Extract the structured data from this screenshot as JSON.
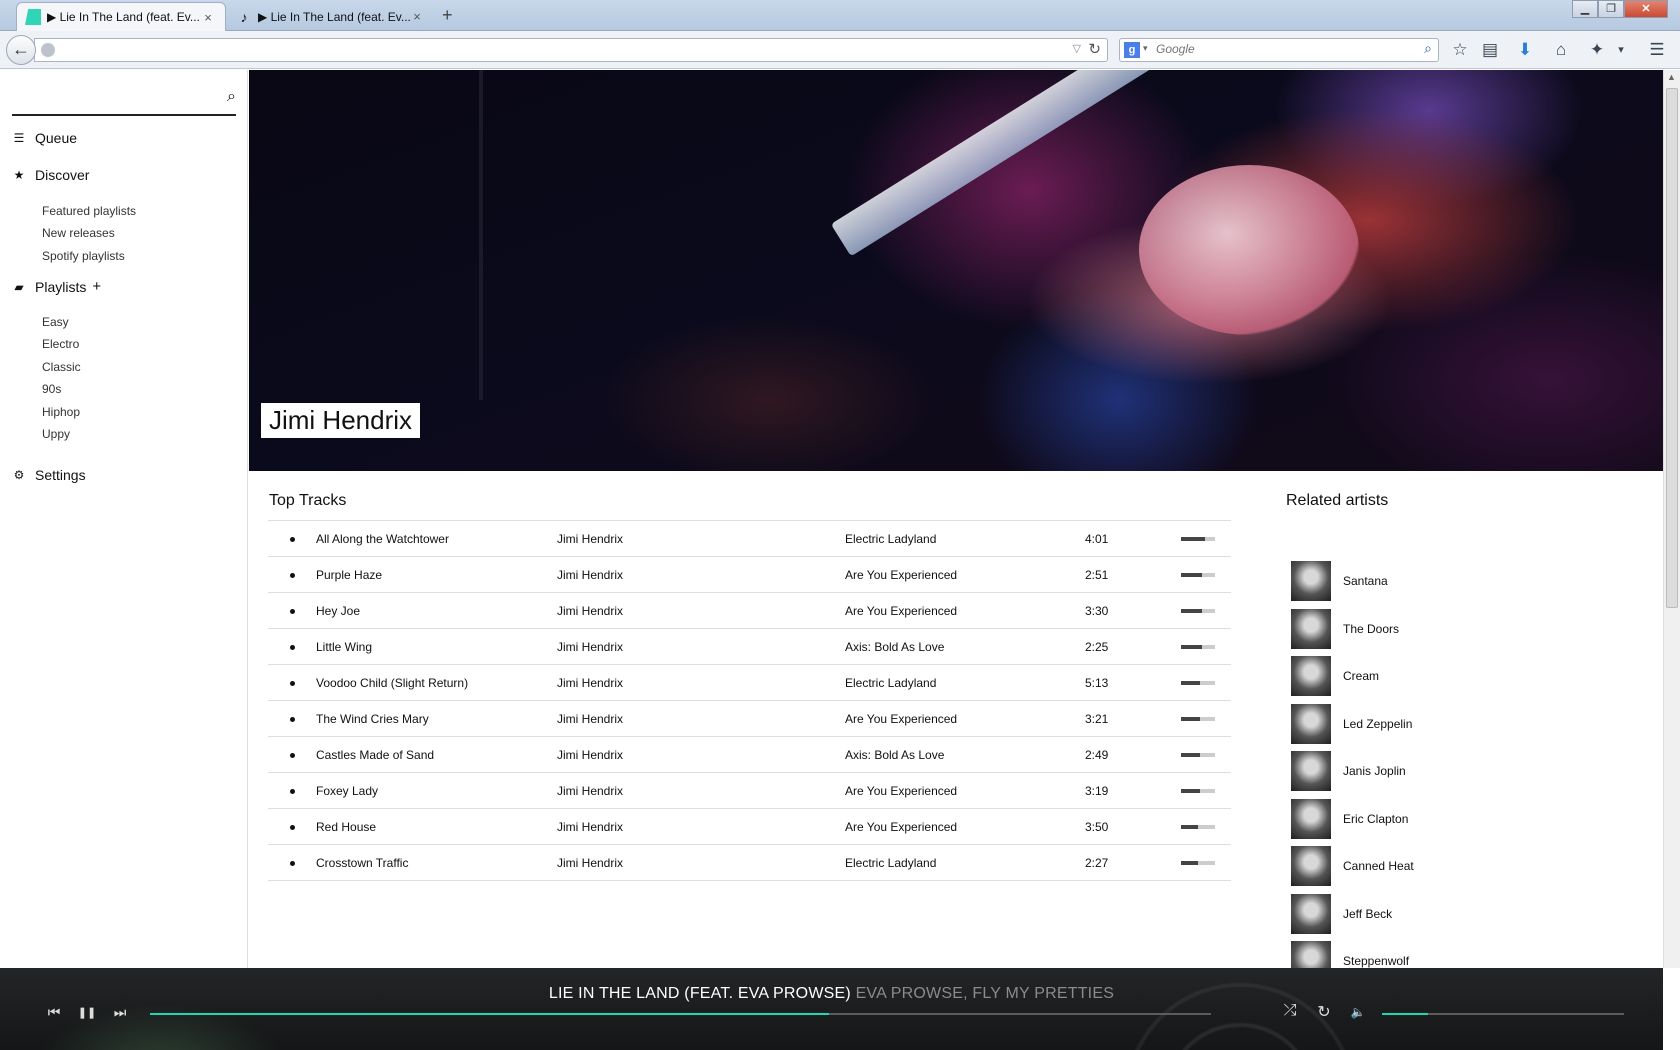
{
  "browser": {
    "tabs": [
      {
        "title": "▶ Lie In The Land (feat. Ev...",
        "close": "×"
      },
      {
        "title": "▶ Lie In The Land (feat. Ev...",
        "close": "×"
      }
    ],
    "new_tab": "+",
    "search_engine": "Google",
    "search_placeholder": "Google"
  },
  "sidebar": {
    "search_placeholder": "",
    "queue": "Queue",
    "discover": "Discover",
    "discover_items": [
      "Featured playlists",
      "New releases",
      "Spotify playlists"
    ],
    "playlists": "Playlists",
    "playlists_add": "+",
    "playlist_items": [
      "Easy",
      "Electro",
      "Classic",
      "90s",
      "Hiphop",
      "Uppy"
    ],
    "settings": "Settings"
  },
  "artist": {
    "name": "Jimi Hendrix"
  },
  "top_tracks": {
    "title": "Top Tracks",
    "rows": [
      {
        "name": "All Along the Watchtower",
        "artist": "Jimi Hendrix",
        "album": "Electric Ladyland",
        "duration": "4:01",
        "popularity": 0.72
      },
      {
        "name": "Purple Haze",
        "artist": "Jimi Hendrix",
        "album": "Are You Experienced",
        "duration": "2:51",
        "popularity": 0.62
      },
      {
        "name": "Hey Joe",
        "artist": "Jimi Hendrix",
        "album": "Are You Experienced",
        "duration": "3:30",
        "popularity": 0.62
      },
      {
        "name": "Little Wing",
        "artist": "Jimi Hendrix",
        "album": "Axis: Bold As Love",
        "duration": "2:25",
        "popularity": 0.62
      },
      {
        "name": "Voodoo Child (Slight Return)",
        "artist": "Jimi Hendrix",
        "album": "Electric Ladyland",
        "duration": "5:13",
        "popularity": 0.55
      },
      {
        "name": "The Wind Cries Mary",
        "artist": "Jimi Hendrix",
        "album": "Are You Experienced",
        "duration": "3:21",
        "popularity": 0.55
      },
      {
        "name": "Castles Made of Sand",
        "artist": "Jimi Hendrix",
        "album": "Axis: Bold As Love",
        "duration": "2:49",
        "popularity": 0.55
      },
      {
        "name": "Foxey Lady",
        "artist": "Jimi Hendrix",
        "album": "Are You Experienced",
        "duration": "3:19",
        "popularity": 0.55
      },
      {
        "name": "Red House",
        "artist": "Jimi Hendrix",
        "album": "Are You Experienced",
        "duration": "3:50",
        "popularity": 0.5
      },
      {
        "name": "Crosstown Traffic",
        "artist": "Jimi Hendrix",
        "album": "Electric Ladyland",
        "duration": "2:27",
        "popularity": 0.5
      }
    ]
  },
  "related_artists": {
    "title": "Related artists",
    "items": [
      "Santana",
      "The Doors",
      "Cream",
      "Led Zeppelin",
      "Janis Joplin",
      "Eric Clapton",
      "Canned Heat",
      "Jeff Beck",
      "Steppenwolf"
    ]
  },
  "player": {
    "song": "LIE IN THE LAND (FEAT. EVA PROWSE)",
    "artists": "EVA PROWSE, FLY MY PRETTIES",
    "progress": 0.64,
    "volume": 0.19,
    "accent": "#1fd7b0"
  },
  "icons": {
    "prev": "⏮",
    "pause": "❚❚",
    "next": "⏭",
    "shuffle": "⤮",
    "repeat": "↻",
    "volume": "🔈",
    "search": "⌕",
    "queue": "☰",
    "discover": "★",
    "playlists": "▰",
    "settings": "⚙"
  }
}
